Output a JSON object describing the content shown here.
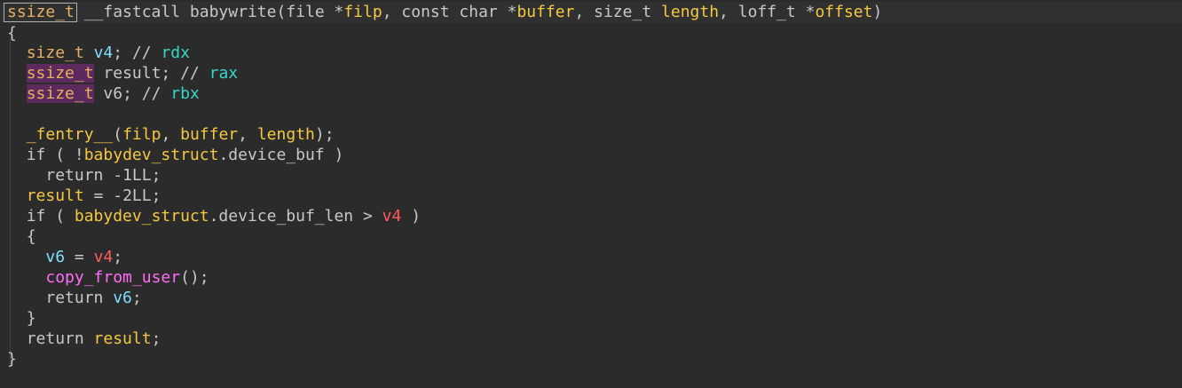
{
  "signature": {
    "ret_type": "ssize_t",
    "callconv": "__fastcall",
    "func_name": "babywrite",
    "open": "(",
    "p1_type": "file *",
    "p1_name": "filp",
    "sep1": ", ",
    "p2_type": "const char *",
    "p2_name": "buffer",
    "sep2": ", ",
    "p3_type": "size_t ",
    "p3_name": "length",
    "sep3": ", ",
    "p4_type": "loff_t *",
    "p4_name": "offset",
    "close": ")"
  },
  "brace_open": "{",
  "brace_close": "}",
  "decls": [
    {
      "type": "size_t",
      "name": "v4",
      "comment": "; // ",
      "reg": "rdx"
    },
    {
      "type": "ssize_t",
      "name": "result",
      "comment": "; // ",
      "reg": "rax"
    },
    {
      "type": "ssize_t",
      "name": "v6",
      "comment": "; // ",
      "reg": "rbx"
    }
  ],
  "body": {
    "fentry_name": "_fentry__",
    "fentry_open": "(",
    "fentry_a1": "filp",
    "fentry_s1": ", ",
    "fentry_a2": "buffer",
    "fentry_s2": ", ",
    "fentry_a3": "length",
    "fentry_close": ");",
    "if1_kw": "if ( !",
    "if1_glb": "babydev_struct",
    "if1_field": ".device_buf",
    "if1_close": " )",
    "ret1": "return -1LL;",
    "assign_var": "result",
    "assign_rest": " = -2LL;",
    "if2_kw": "if ( ",
    "if2_glb": "babydev_struct",
    "if2_field": ".device_buf_len > ",
    "if2_var": "v4",
    "if2_close": " )",
    "inner_open": "{",
    "v6_name": "v6",
    "v6_eq": " = ",
    "v6_val": "v4",
    "v6_semi": ";",
    "cfu_name": "copy_from_user",
    "cfu_rest": "();",
    "ret2_kw": "return ",
    "ret2_var": "v6",
    "ret2_semi": ";",
    "inner_close": "}",
    "ret3_kw": "return ",
    "ret3_var": "result",
    "ret3_semi": ";"
  }
}
